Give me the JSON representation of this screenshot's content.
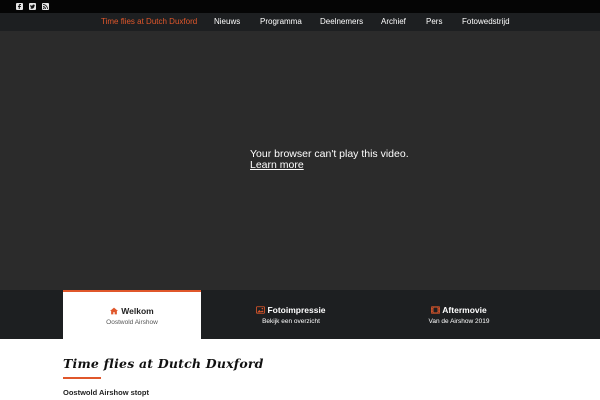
{
  "topbar": {
    "social": [
      {
        "icon": "facebook-icon"
      },
      {
        "icon": "twitter-icon"
      },
      {
        "icon": "rss-icon"
      }
    ]
  },
  "nav": {
    "items": [
      {
        "label": "Time flies at Dutch Duxford",
        "active": true
      },
      {
        "label": "Nieuws"
      },
      {
        "label": "Programma"
      },
      {
        "label": "Deelnemers"
      },
      {
        "label": "Archief"
      },
      {
        "label": "Pers"
      },
      {
        "label": "Fotowedstrijd"
      }
    ]
  },
  "video": {
    "message": "Your browser can't play this video.",
    "link": "Learn more"
  },
  "tabs": [
    {
      "title": "Welkom",
      "subtitle": "Oostwold Airshow",
      "icon": "home-icon",
      "active": true
    },
    {
      "title": "Fotoimpressie",
      "subtitle": "Bekijk een overzicht",
      "icon": "image-icon"
    },
    {
      "title": "Aftermovie",
      "subtitle": "Van de Airshow 2019",
      "icon": "film-icon"
    }
  ],
  "content": {
    "heading": "Time flies at Dutch Duxford",
    "subheading": "Oostwold Airshow stopt"
  },
  "colors": {
    "accent": "#e0572b",
    "nav_bg": "#1d1f21",
    "video_bg": "#2b2b2b",
    "topbar_bg": "#050505"
  }
}
